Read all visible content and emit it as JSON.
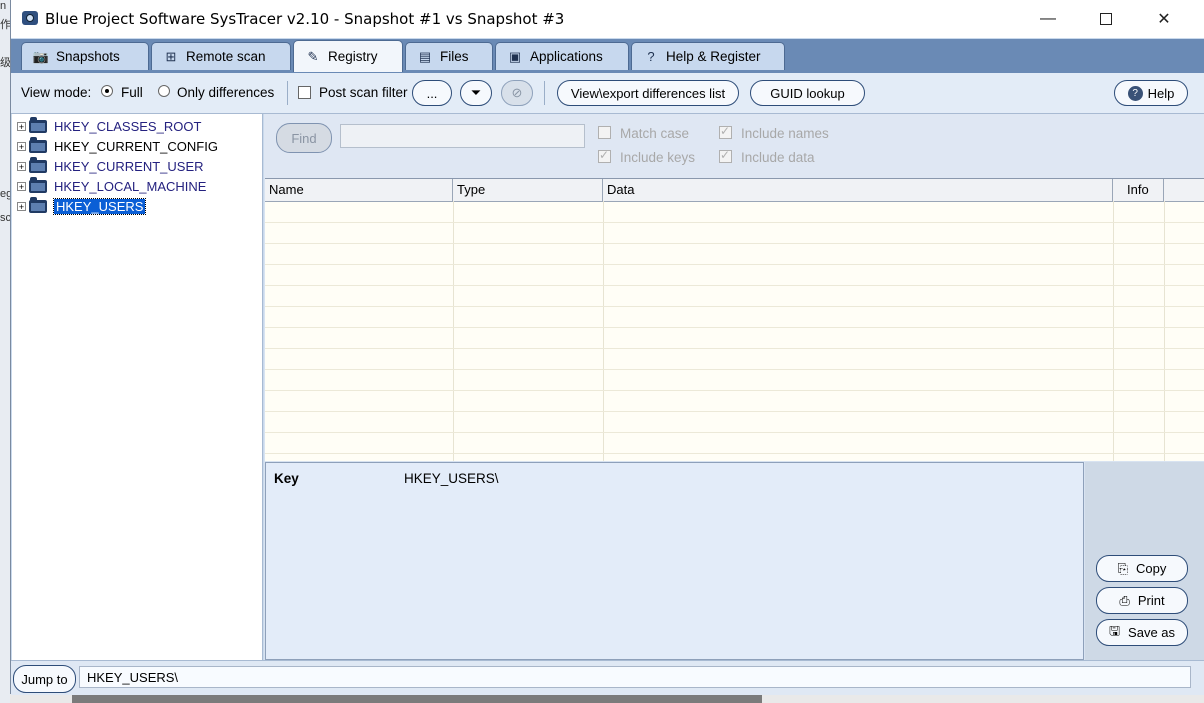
{
  "window": {
    "title": "Blue Project Software SysTracer v2.10 - Snapshot #1 vs Snapshot #3"
  },
  "desktop_fragments": [
    "n",
    "作",
    "级",
    "eg",
    "sc"
  ],
  "tabs": [
    {
      "label": "Snapshots",
      "icon": "camera-icon"
    },
    {
      "label": "Remote scan",
      "icon": "network-icon"
    },
    {
      "label": "Registry",
      "icon": "registry-icon"
    },
    {
      "label": "Files",
      "icon": "files-icon"
    },
    {
      "label": "Applications",
      "icon": "applications-icon"
    },
    {
      "label": "Help & Register",
      "icon": "help-icon"
    }
  ],
  "toolbar": {
    "view_mode_label": "View mode:",
    "full_label": "Full",
    "only_diff_label": "Only differences",
    "post_scan_filter_label": "Post scan filter",
    "ellipsis_label": "...",
    "view_export_label": "View\\export differences list",
    "guid_lookup_label": "GUID lookup",
    "help_label": "Help"
  },
  "tree": {
    "nodes": [
      {
        "label": "HKEY_CLASSES_ROOT"
      },
      {
        "label": "HKEY_CURRENT_CONFIG"
      },
      {
        "label": "HKEY_CURRENT_USER"
      },
      {
        "label": "HKEY_LOCAL_MACHINE"
      },
      {
        "label": "HKEY_USERS"
      }
    ]
  },
  "find": {
    "button_label": "Find",
    "match_case_label": "Match case",
    "include_names_label": "Include names",
    "include_keys_label": "Include keys",
    "include_data_label": "Include data"
  },
  "grid": {
    "columns": [
      "Name",
      "Type",
      "Data",
      "Info"
    ]
  },
  "detail": {
    "key_label": "Key",
    "key_value": "HKEY_USERS\\"
  },
  "actions": {
    "copy_label": "Copy",
    "print_label": "Print",
    "save_as_label": "Save as"
  },
  "status": {
    "jump_label": "Jump to",
    "jump_value": "HKEY_USERS\\"
  }
}
